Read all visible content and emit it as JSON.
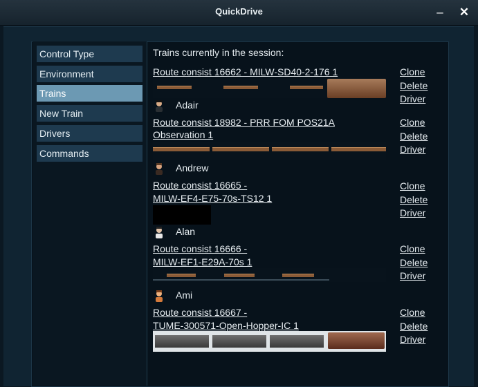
{
  "window": {
    "title": "QuickDrive",
    "minimize_glyph": "–",
    "close_glyph": "✕"
  },
  "sidebar": {
    "items": [
      {
        "label": "Control Type"
      },
      {
        "label": "Environment"
      },
      {
        "label": "Trains",
        "active": true
      },
      {
        "label": "New Train"
      },
      {
        "label": "Drivers"
      },
      {
        "label": "Commands"
      }
    ]
  },
  "content": {
    "header": "Trains currently in the session:",
    "trains": [
      {
        "consist_line1": "Route consist 16662 - MILW-SD40-2-176 1",
        "consist_line2": "",
        "driver": "Adair",
        "clone": "Clone",
        "delete": "Delete",
        "driver_link": "Driver"
      },
      {
        "consist_line1": "Route consist 18982 - PRR FOM POS21A",
        "consist_line2": "Observation 1",
        "driver": "Andrew",
        "clone": "Clone",
        "delete": "Delete",
        "driver_link": "Driver"
      },
      {
        "consist_line1": "Route consist 16665 -",
        "consist_line2": "MILW-EF4-E75-70s-TS12 1",
        "driver": "Alan",
        "clone": "Clone",
        "delete": "Delete",
        "driver_link": "Driver"
      },
      {
        "consist_line1": "Route consist 16666 -",
        "consist_line2": "MILW-EF1-E29A-70s 1",
        "driver": "Ami",
        "clone": "Clone",
        "delete": "Delete",
        "driver_link": "Driver"
      },
      {
        "consist_line1": "Route consist 16667 -",
        "consist_line2": "TUME-300571-Open-Hopper-IC 1",
        "driver": "",
        "clone": "Clone",
        "delete": "Delete",
        "driver_link": "Driver"
      }
    ]
  },
  "colors": {
    "background": "#0b1822",
    "panel": "#102432",
    "nav_item": "#1e3a4f",
    "nav_active": "#6c99b3",
    "text": "#e4ebef",
    "car_body": "#8a5b37"
  },
  "icons": {
    "minimize": "minimize-icon",
    "close": "close-icon",
    "driver": "driver-portrait-icon"
  }
}
